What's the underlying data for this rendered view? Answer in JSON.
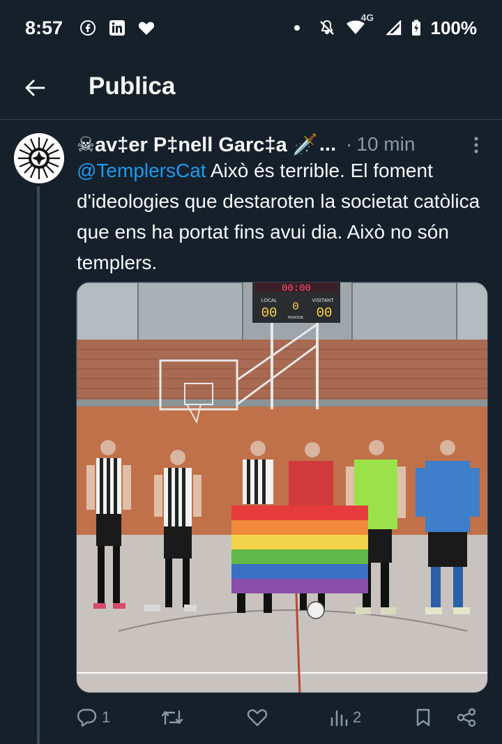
{
  "status_bar": {
    "time": "8:57",
    "network": "4G",
    "battery": "100%",
    "icons": [
      "facebook-icon",
      "linkedin-icon",
      "heart-icon",
      "dot-icon",
      "mute-icon",
      "wifi-icon",
      "signal-icon",
      "battery-icon"
    ]
  },
  "header": {
    "title": "Publica"
  },
  "tweet": {
    "display_name": "☠av‡er P‡nell Garc‡a 🗡️",
    "name_ellipsis": "...",
    "separator": "·",
    "time_ago": "10 min",
    "mention": "@TemplersCat",
    "text_after_mention": " Això és terrible. El foment d'ideologies que destaroten la societat catòlica que ens ha portat fins avui dia. Això no són templers.",
    "scoreboard": {
      "time": "00:00",
      "local_label": "LOCAL",
      "visitant_label": "VISITANT",
      "periode_label": "PERIODE",
      "local_score": "00",
      "periode": "0",
      "visitant_score": "00"
    },
    "actions": {
      "reply_count": "1",
      "views_count": "2"
    }
  },
  "colors": {
    "background": "#15202b",
    "text": "#f7f9f9",
    "secondary": "#8b98a5",
    "accent": "#1d9bf0",
    "divider": "#38444d"
  }
}
